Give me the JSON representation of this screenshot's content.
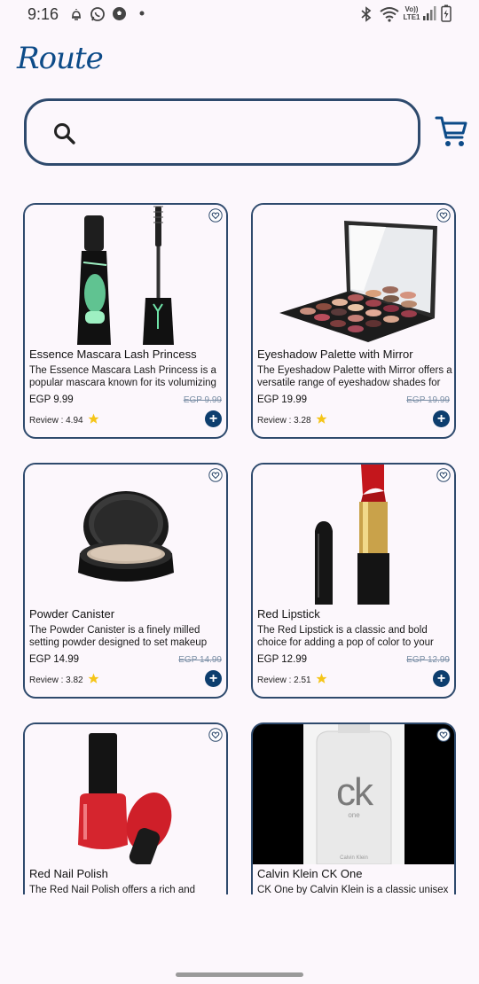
{
  "status_bar": {
    "time": "9:16",
    "network_top": "Vo))",
    "network_bottom": "LTE1",
    "icons": [
      "notification-bell-icon",
      "whatsapp-icon",
      "football-icon",
      "dot-icon",
      "bluetooth-icon",
      "wifi-icon",
      "signal-icon",
      "battery-icon"
    ]
  },
  "app": {
    "logo": "Route"
  },
  "search": {
    "placeholder": "",
    "value": ""
  },
  "colors": {
    "primary": "#0D3E6E",
    "border": "#2E4A6D",
    "background": "#FCF7FC",
    "star": "#F5C518"
  },
  "products": [
    {
      "title": "Essence Mascara Lash Princess",
      "description": "The Essence Mascara Lash Princess is a popular mascara known for its volumizing",
      "price": "EGP 9.99",
      "old_price": "EGP 9.99",
      "review": "Review : 4.94",
      "rating": 4.94
    },
    {
      "title": "Eyeshadow Palette with Mirror",
      "description": "The Eyeshadow Palette with Mirror offers a versatile range of eyeshadow shades for",
      "price": "EGP 19.99",
      "old_price": "EGP 19.99",
      "review": "Review : 3.28",
      "rating": 3.28
    },
    {
      "title": "Powder Canister",
      "description": "The Powder Canister is a finely milled setting powder designed to set makeup",
      "price": "EGP 14.99",
      "old_price": "EGP 14.99",
      "review": "Review : 3.82",
      "rating": 3.82
    },
    {
      "title": "Red Lipstick",
      "description": "The Red Lipstick is a classic and bold choice for adding a pop of color to your",
      "price": "EGP 12.99",
      "old_price": "EGP 12.99",
      "review": "Review : 2.51",
      "rating": 2.51
    },
    {
      "title": "Red Nail Polish",
      "description": "The Red Nail Polish offers a rich and"
    },
    {
      "title": "Calvin Klein CK One",
      "description": "CK One by Calvin Klein is a classic unisex",
      "image_text_logo": "ck",
      "image_text_sub": "one",
      "image_text_brand": "Calvin Klein"
    }
  ]
}
